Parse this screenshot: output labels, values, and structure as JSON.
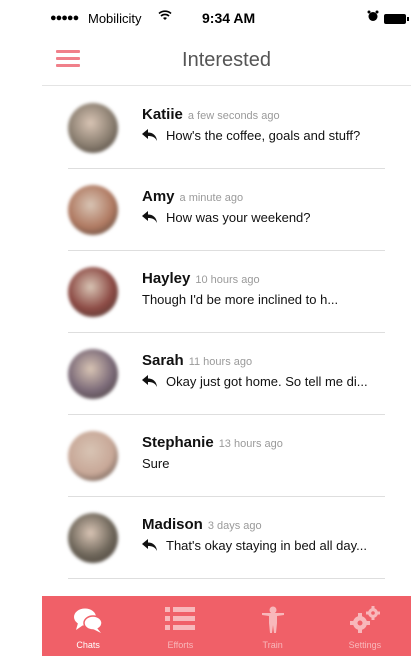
{
  "status_bar": {
    "signal": "●●●●●",
    "carrier": "Mobilicity",
    "time": "9:34 AM"
  },
  "header": {
    "title": "Interested"
  },
  "chats": [
    {
      "name": "Katiie",
      "time": "a few seconds ago",
      "message": "How's the coffee, goals and stuff?",
      "replied": true,
      "avatar_color": "#8a7e70"
    },
    {
      "name": "Amy",
      "time": "a minute ago",
      "message": "How was your weekend?",
      "replied": true,
      "avatar_color": "#b07a62"
    },
    {
      "name": "Hayley",
      "time": "10 hours ago",
      "message": "Though I'd be more inclined to h...",
      "replied": false,
      "avatar_color": "#8c4a44"
    },
    {
      "name": "Sarah",
      "time": "11 hours ago",
      "message": "Okay just got home. So tell me di...",
      "replied": true,
      "avatar_color": "#7b6a78"
    },
    {
      "name": "Stephanie",
      "time": "13 hours ago",
      "message": "Sure",
      "replied": false,
      "avatar_color": "#c8a898"
    },
    {
      "name": "Madison",
      "time": "3 days ago",
      "message": "That's okay staying in bed all day...",
      "replied": true,
      "avatar_color": "#6e665a"
    }
  ],
  "tabs": [
    {
      "label": "Chats",
      "icon": "chat-bubbles-icon",
      "active": true
    },
    {
      "label": "Efforts",
      "icon": "list-icon",
      "active": false
    },
    {
      "label": "Train",
      "icon": "person-icon",
      "active": false
    },
    {
      "label": "Settings",
      "icon": "gears-icon",
      "active": false
    }
  ],
  "colors": {
    "accent": "#f06068",
    "menu_icon": "#f0808a",
    "tab_label_inactive": "#f8b8bb"
  }
}
